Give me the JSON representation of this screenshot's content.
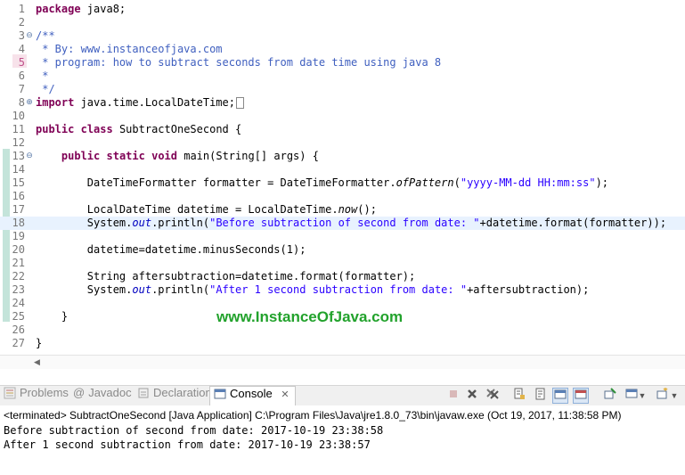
{
  "editor": {
    "lines": [
      {
        "n": "1",
        "fold": "",
        "code": [
          {
            "t": "package",
            "c": "kw"
          },
          {
            "t": " java8;",
            "c": ""
          }
        ]
      },
      {
        "n": "2",
        "fold": "",
        "code": []
      },
      {
        "n": "3",
        "fold": "⊖",
        "code": [
          {
            "t": "/**",
            "c": "cm"
          }
        ]
      },
      {
        "n": "4",
        "fold": "",
        "code": [
          {
            "t": " * By: www.instanceofjava.com",
            "c": "cm"
          }
        ]
      },
      {
        "n": "5",
        "fold": "",
        "hl": true,
        "code": [
          {
            "t": " * program: how to subtract seconds from date time using java 8",
            "c": "cm"
          }
        ]
      },
      {
        "n": "6",
        "fold": "",
        "code": [
          {
            "t": " *",
            "c": "cm"
          }
        ]
      },
      {
        "n": "7",
        "fold": "",
        "code": [
          {
            "t": " */",
            "c": "cm"
          }
        ]
      },
      {
        "n": "8",
        "fold": "⊕",
        "code": [
          {
            "t": "import",
            "c": "kw"
          },
          {
            "t": " java.time.LocalDateTime;",
            "c": ""
          }
        ]
      },
      {
        "n": "10",
        "fold": "",
        "code": []
      },
      {
        "n": "11",
        "fold": "",
        "code": [
          {
            "t": "public",
            "c": "kw"
          },
          {
            "t": " ",
            "c": ""
          },
          {
            "t": "class",
            "c": "kw"
          },
          {
            "t": " SubtractOneSecond {",
            "c": ""
          }
        ]
      },
      {
        "n": "12",
        "fold": "",
        "code": []
      },
      {
        "n": "13",
        "fold": "⊖",
        "code": [
          {
            "t": "    ",
            "c": ""
          },
          {
            "t": "public",
            "c": "kw"
          },
          {
            "t": " ",
            "c": ""
          },
          {
            "t": "static",
            "c": "kw"
          },
          {
            "t": " ",
            "c": ""
          },
          {
            "t": "void",
            "c": "kw"
          },
          {
            "t": " main(String[] args) {",
            "c": ""
          }
        ]
      },
      {
        "n": "14",
        "fold": "",
        "code": []
      },
      {
        "n": "15",
        "fold": "",
        "code": [
          {
            "t": "        DateTimeFormatter formatter = DateTimeFormatter.",
            "c": ""
          },
          {
            "t": "ofPattern",
            "c": "it"
          },
          {
            "t": "(",
            "c": ""
          },
          {
            "t": "\"yyyy-MM-dd HH:mm:ss\"",
            "c": "str"
          },
          {
            "t": ");",
            "c": ""
          }
        ]
      },
      {
        "n": "16",
        "fold": "",
        "code": []
      },
      {
        "n": "17",
        "fold": "",
        "code": [
          {
            "t": "        LocalDateTime datetime = LocalDateTime.",
            "c": ""
          },
          {
            "t": "now",
            "c": "it"
          },
          {
            "t": "();",
            "c": ""
          }
        ]
      },
      {
        "n": "18",
        "fold": "",
        "cur": true,
        "code": [
          {
            "t": "        System.",
            "c": ""
          },
          {
            "t": "out",
            "c": "fi"
          },
          {
            "t": ".println(",
            "c": ""
          },
          {
            "t": "\"Before subtraction of second from date: \"",
            "c": "str"
          },
          {
            "t": "+datetime.format(formatter));",
            "c": ""
          }
        ]
      },
      {
        "n": "19",
        "fold": "",
        "code": []
      },
      {
        "n": "20",
        "fold": "",
        "code": [
          {
            "t": "        datetime=datetime.minusSeconds(1);",
            "c": ""
          }
        ]
      },
      {
        "n": "21",
        "fold": "",
        "code": []
      },
      {
        "n": "22",
        "fold": "",
        "code": [
          {
            "t": "        String aftersubtraction=datetime.format(formatter);",
            "c": ""
          }
        ]
      },
      {
        "n": "23",
        "fold": "",
        "code": [
          {
            "t": "        System.",
            "c": ""
          },
          {
            "t": "out",
            "c": "fi"
          },
          {
            "t": ".println(",
            "c": ""
          },
          {
            "t": "\"After 1 second subtraction from date: \"",
            "c": "str"
          },
          {
            "t": "+aftersubtraction);",
            "c": ""
          }
        ]
      },
      {
        "n": "24",
        "fold": "",
        "code": []
      },
      {
        "n": "25",
        "fold": "",
        "code": [
          {
            "t": "    }",
            "c": ""
          }
        ]
      },
      {
        "n": "26",
        "fold": "",
        "code": []
      },
      {
        "n": "27",
        "fold": "",
        "code": [
          {
            "t": "}",
            "c": ""
          }
        ]
      }
    ]
  },
  "watermark": "www.InstanceOfJava.com",
  "tabs": {
    "problems": "Problems",
    "javadoc": "Javadoc",
    "declaration": "Declaration",
    "console": "Console",
    "close_glyph": "✕",
    "at_glyph": "@"
  },
  "toolbar_icons": [
    "terminate-icon",
    "remove-launch-icon",
    "remove-all-icon",
    "scroll-lock-icon",
    "word-wrap-icon",
    "show-on-stdout-icon",
    "show-on-stderr-icon",
    "pin-console-icon",
    "display-console-icon",
    "dropdown-icon",
    "open-console-icon",
    "dropdown-icon",
    "view-menu-icon"
  ],
  "console": {
    "terminated": "<terminated> SubtractOneSecond [Java Application] C:\\Program Files\\Java\\jre1.8.0_73\\bin\\javaw.exe (Oct 19, 2017, 11:38:58 PM)",
    "output": [
      "Before subtraction of second from date: 2017-10-19 23:38:58",
      "After 1 second subtraction from date: 2017-10-19 23:38:57"
    ]
  },
  "colors": {
    "keyword": "#7f0055",
    "comment": "#3f5fbf",
    "string": "#2a00ff",
    "watermark": "#22a22c"
  }
}
